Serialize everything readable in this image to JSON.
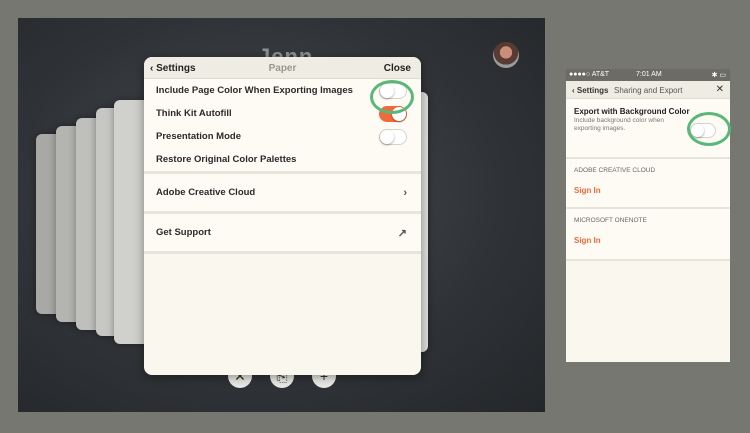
{
  "ipad": {
    "background_title": "Jenn",
    "bottom_icons": [
      "close-icon",
      "share-icon",
      "add-icon"
    ]
  },
  "popover": {
    "back_label": "‹ Settings",
    "title": "Paper",
    "close_label": "Close",
    "rows": [
      {
        "label": "Include Page Color When Exporting Images",
        "toggle": "off"
      },
      {
        "label": "Think Kit Autofill",
        "toggle": "on"
      },
      {
        "label": "Presentation Mode",
        "toggle": "off"
      },
      {
        "label": "Restore Original Color Palettes"
      }
    ],
    "adobe_label": "Adobe Creative Cloud",
    "adobe_chevron": "›",
    "support_label": "Get Support",
    "support_arrow": "↗"
  },
  "phone": {
    "carrier": "●●●●○ AT&T",
    "time": "7:01 AM",
    "battery": "✱ ▭",
    "back_label": "‹ Settings",
    "title": "Sharing and Export",
    "close_glyph": "✕",
    "export_title": "Export with Background Color",
    "export_desc": "Include background color when exporting images.",
    "adobe_head": "ADOBE CREATIVE CLOUD",
    "adobe_signin": "Sign In",
    "ms_head": "MICROSOFT ONENOTE",
    "ms_signin": "Sign In"
  },
  "colors": {
    "accent": "#f06b3c",
    "highlight_ring": "#59b878",
    "background": "#777772"
  }
}
